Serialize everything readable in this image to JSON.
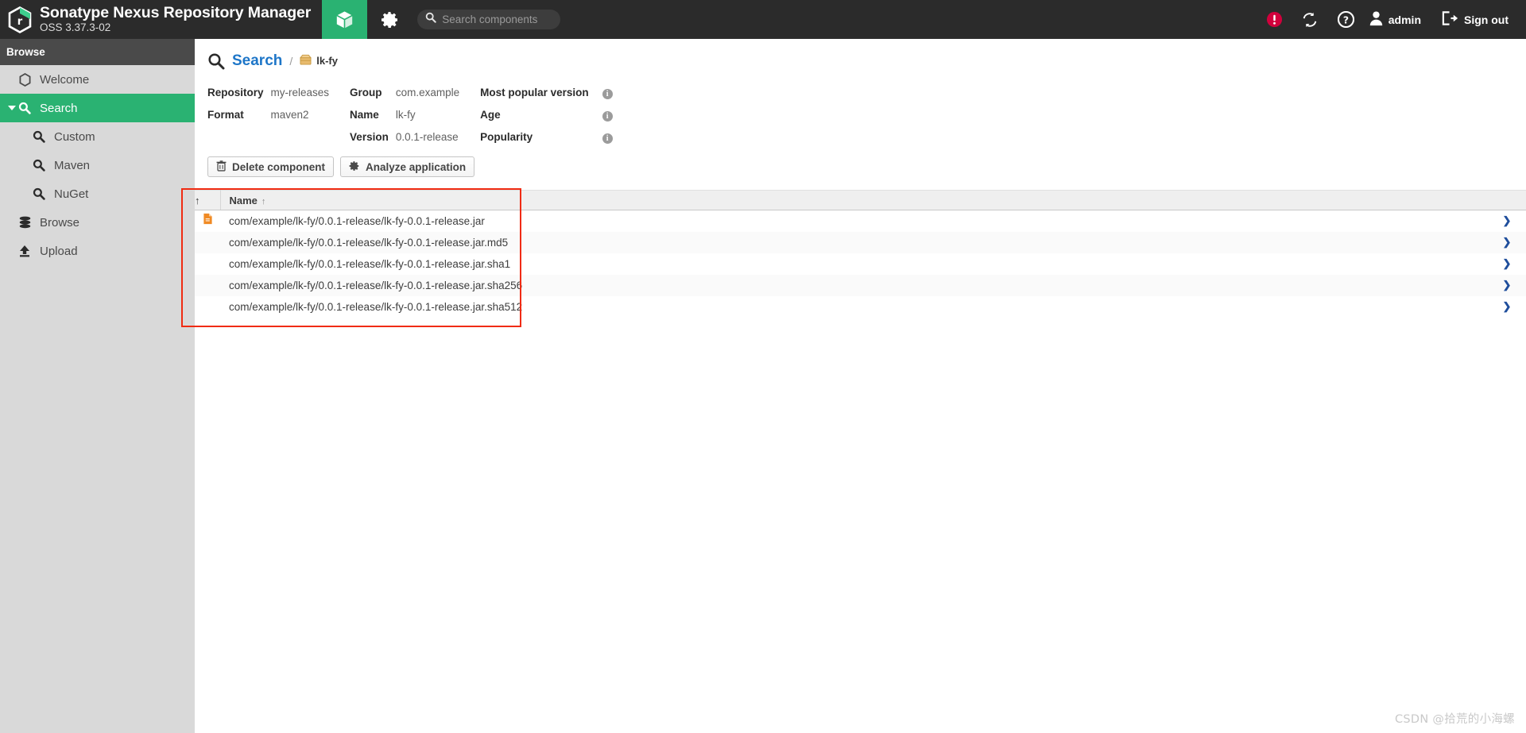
{
  "app": {
    "title": "Sonatype Nexus Repository Manager",
    "version": "OSS 3.37.3-02",
    "logo_icon": "nexus-hex-logo-icon"
  },
  "topnav": {
    "tabs": [
      {
        "name": "browse",
        "icon": "cube-icon",
        "active": true
      },
      {
        "name": "admin",
        "icon": "gear-icon",
        "active": false
      }
    ],
    "search": {
      "placeholder": "Search components",
      "value": "",
      "icon": "search-icon"
    },
    "right": {
      "alert_icon": "error-circle-icon",
      "refresh_icon": "refresh-icon",
      "help_icon": "help-circle-icon",
      "user_icon": "user-icon",
      "user_label": "admin",
      "signout_icon": "sign-out-icon",
      "signout_label": "Sign out"
    }
  },
  "sidebar": {
    "header": "Browse",
    "items": [
      {
        "label": "Welcome",
        "icon": "hexagon-icon",
        "level": 1,
        "active": false
      },
      {
        "label": "Search",
        "icon": "search-icon",
        "level": 1,
        "active": true,
        "expanded": true
      },
      {
        "label": "Custom",
        "icon": "search-icon",
        "level": 2,
        "active": false
      },
      {
        "label": "Maven",
        "icon": "search-icon",
        "level": 2,
        "active": false
      },
      {
        "label": "NuGet",
        "icon": "search-icon",
        "level": 2,
        "active": false
      },
      {
        "label": "Browse",
        "icon": "database-icon",
        "level": 1,
        "active": false
      },
      {
        "label": "Upload",
        "icon": "upload-icon",
        "level": 1,
        "active": false
      }
    ]
  },
  "main": {
    "breadcrumb": {
      "search_icon": "search-icon",
      "root_label": "Search",
      "separator": "/",
      "leaf_icon": "package-box-icon",
      "leaf_label": "lk-fy"
    },
    "details": {
      "rows": [
        {
          "col1_label": "Repository",
          "col1_value": "my-releases",
          "col2_label": "Group",
          "col2_value": "com.example",
          "col3_label": "Most popular version",
          "col3_value": "",
          "col3_info": "info-icon"
        },
        {
          "col1_label": "Format",
          "col1_value": "maven2",
          "col2_label": "Name",
          "col2_value": "lk-fy",
          "col3_label": "Age",
          "col3_value": "",
          "col3_info": "info-icon"
        },
        {
          "col1_label": "",
          "col1_value": "",
          "col2_label": "Version",
          "col2_value": "0.0.1-release",
          "col3_label": "Popularity",
          "col3_value": "",
          "col3_info": "info-icon"
        }
      ]
    },
    "buttons": [
      {
        "label": "Delete component",
        "icon": "trash-icon"
      },
      {
        "label": "Analyze application",
        "icon": "gear-icon"
      }
    ],
    "table": {
      "columns": [
        {
          "key": "grip",
          "label": ""
        },
        {
          "key": "name",
          "label": "Name",
          "sort_icon": "sort-asc-icon"
        }
      ],
      "rows": [
        {
          "icon": "jar-file-icon",
          "name": "com/example/lk-fy/0.0.1-release/lk-fy-0.0.1-release.jar",
          "chevron": "chevron-right-icon"
        },
        {
          "icon": "",
          "name": "com/example/lk-fy/0.0.1-release/lk-fy-0.0.1-release.jar.md5",
          "chevron": "chevron-right-icon"
        },
        {
          "icon": "",
          "name": "com/example/lk-fy/0.0.1-release/lk-fy-0.0.1-release.jar.sha1",
          "chevron": "chevron-right-icon"
        },
        {
          "icon": "",
          "name": "com/example/lk-fy/0.0.1-release/lk-fy-0.0.1-release.jar.sha256",
          "chevron": "chevron-right-icon"
        },
        {
          "icon": "",
          "name": "com/example/lk-fy/0.0.1-release/lk-fy-0.0.1-release.jar.sha512",
          "chevron": "chevron-right-icon"
        }
      ]
    },
    "annotation": {
      "name": "red-highlight-box",
      "color": "#f02b12"
    }
  },
  "watermark": "CSDN @拾荒的小海螺",
  "colors": {
    "accent_green": "#2ab272",
    "topbar": "#2b2b2b",
    "sidebar": "#d9d9d9",
    "link_blue": "#1e76c8",
    "alert_red": "#d1003c",
    "annotation_red": "#f02b12"
  }
}
